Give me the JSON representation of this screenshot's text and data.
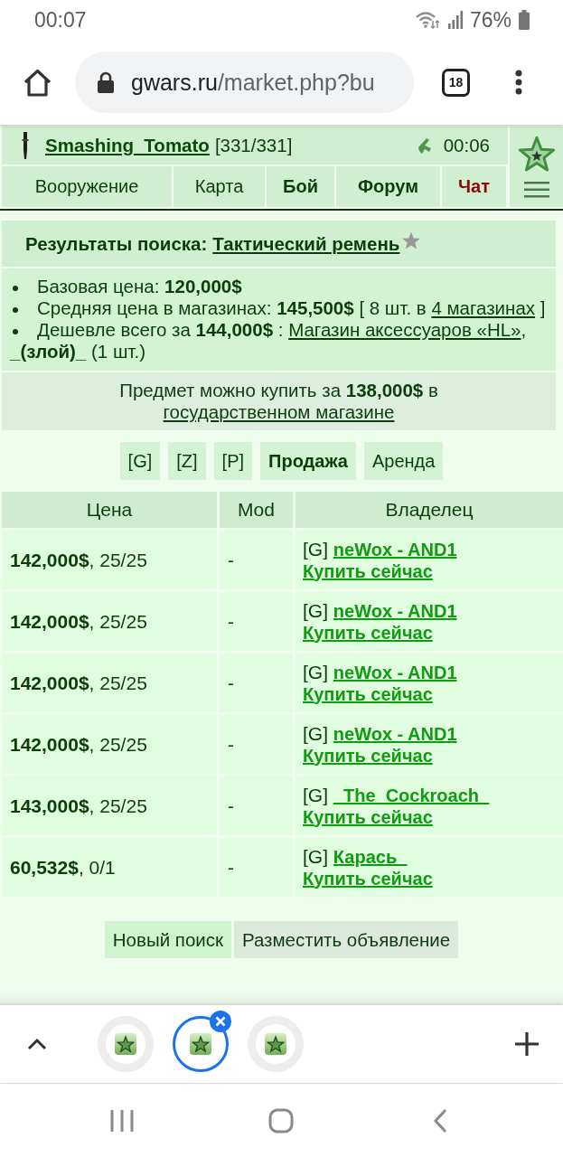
{
  "status_bar": {
    "time": "00:07",
    "battery_text": "76%"
  },
  "browser": {
    "url_host": "gwars.ru",
    "url_path": "/market.php?bu",
    "tab_count": "18"
  },
  "game_header": {
    "player": "Smashing_Tomato",
    "hp": "[331/331]",
    "clock": "00:06",
    "nav": [
      {
        "label": "Вооружение",
        "kind": "plain"
      },
      {
        "label": "Карта",
        "kind": "plain"
      },
      {
        "label": "Бой",
        "kind": "bold"
      },
      {
        "label": "Форум",
        "kind": "bold"
      },
      {
        "label": "Чат",
        "kind": "alert"
      }
    ]
  },
  "search": {
    "heading": "Результаты поиска:",
    "item": "Тактический ремень",
    "facts": [
      {
        "text": "Базовая цена: **120,000$**"
      },
      {
        "text": "Средняя цена в магазинах: **145,500$** [ 8 шт. в ",
        "link": "4 магазинах",
        "after": " ]"
      },
      {
        "text": "Дешевле всего за **144,000$** : ",
        "link": "Магазин аксессуаров «HL»",
        "after": ", **_(злой)_** (1 шт.)"
      }
    ],
    "state_offer": {
      "text": "Предмет можно купить за **138,000$** в ",
      "link": "государственном магазине"
    }
  },
  "filters": [
    {
      "label": "[G]",
      "selected": false
    },
    {
      "label": "[Z]",
      "selected": false
    },
    {
      "label": "[P]",
      "selected": false
    },
    {
      "label": "Продажа",
      "selected": true
    },
    {
      "label": "Аренда",
      "selected": false
    }
  ],
  "table": {
    "columns": [
      "Цена",
      "Mod",
      "Владелец"
    ],
    "rows": [
      {
        "price": "**142,000$**, 25/25",
        "mod": "-",
        "clan": "[G]",
        "owner": "neWox - AND1",
        "action": "Купить сейчас"
      },
      {
        "price": "**142,000$**, 25/25",
        "mod": "-",
        "clan": "[G]",
        "owner": "neWox - AND1",
        "action": "Купить сейчас"
      },
      {
        "price": "**142,000$**, 25/25",
        "mod": "-",
        "clan": "[G]",
        "owner": "neWox - AND1",
        "action": "Купить сейчас"
      },
      {
        "price": "**142,000$**, 25/25",
        "mod": "-",
        "clan": "[G]",
        "owner": "neWox - AND1",
        "action": "Купить сейчас"
      },
      {
        "price": "**143,000$**, 25/25",
        "mod": "-",
        "clan": "[G]",
        "owner": "_The_Cockroach_",
        "action": "Купить сейчас"
      },
      {
        "price": "**60,532$**, 0/1",
        "mod": "-",
        "clan": "[G]",
        "owner": "Карась_",
        "action": "Купить сейчас"
      }
    ]
  },
  "actions": [
    {
      "label": "Новый поиск",
      "highlighted": true
    },
    {
      "label": "Разместить объявление",
      "highlighted": false
    }
  ],
  "tab_strip": {
    "tabs": [
      {
        "selected": false
      },
      {
        "selected": true
      },
      {
        "selected": false
      }
    ]
  }
}
